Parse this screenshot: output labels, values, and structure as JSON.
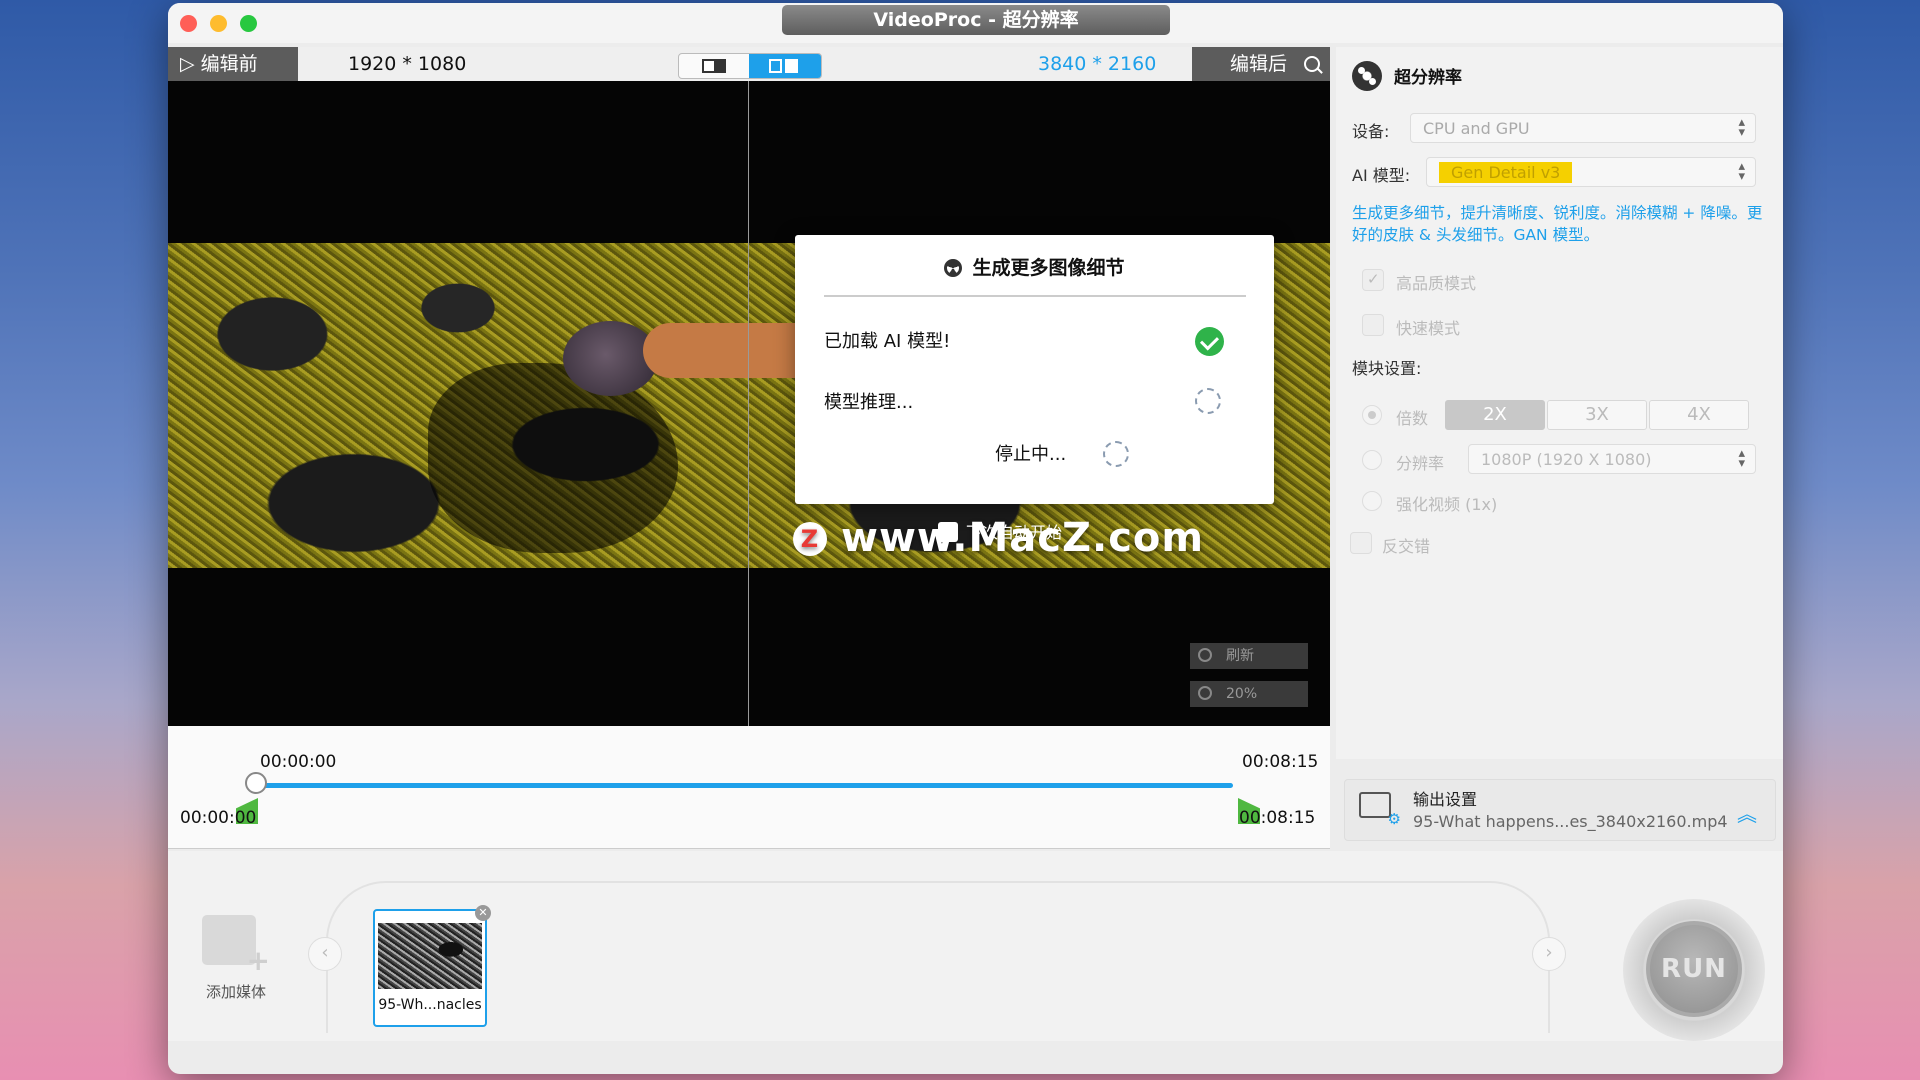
{
  "window": {
    "title": "VideoProc - 超分辨率"
  },
  "preview": {
    "before_label": "▷ 编辑前",
    "before_resolution": "1920 * 1080",
    "after_resolution": "3840 * 2160",
    "after_label": "编辑后",
    "refresh_label": "刷新",
    "zoom_label": "20%"
  },
  "dialog": {
    "title": "生成更多图像细节",
    "row1": "已加载 AI 模型!",
    "row2": "模型推理...",
    "row3": "停止中..."
  },
  "watermark": {
    "logo": "Z",
    "text": "www.MacZ.com",
    "sub": "下次自动开始"
  },
  "timeline": {
    "top_start": "00:00:00",
    "top_end": "00:08:15",
    "bottom_start": "00:00:00",
    "bottom_end": "00:08:15"
  },
  "panel": {
    "title": "超分辨率",
    "device_label": "设备:",
    "device_value": "CPU and GPU",
    "model_label": "AI 模型:",
    "model_value": "Gen Detail v3",
    "description": "生成更多细节，提升清晰度、锐利度。消除模糊 + 降噪。更好的皮肤 & 头发细节。GAN 模型。",
    "high_quality_label": "高品质模式",
    "fast_mode_label": "快速模式",
    "module_settings_label": "模块设置:",
    "scale_label": "倍数",
    "scale_options": [
      "2X",
      "3X",
      "4X"
    ],
    "resolution_label": "分辨率",
    "resolution_value": "1080P (1920 X 1080)",
    "enhance_label": "强化视频 (1x)",
    "deinterlace_label": "反交错"
  },
  "output": {
    "title": "输出设置",
    "filename": "95-What happens...es_3840x2160.mp4"
  },
  "media": {
    "add_label": "添加媒体",
    "clip_label": "95-Wh...nacles"
  },
  "run": {
    "label": "RUN"
  }
}
